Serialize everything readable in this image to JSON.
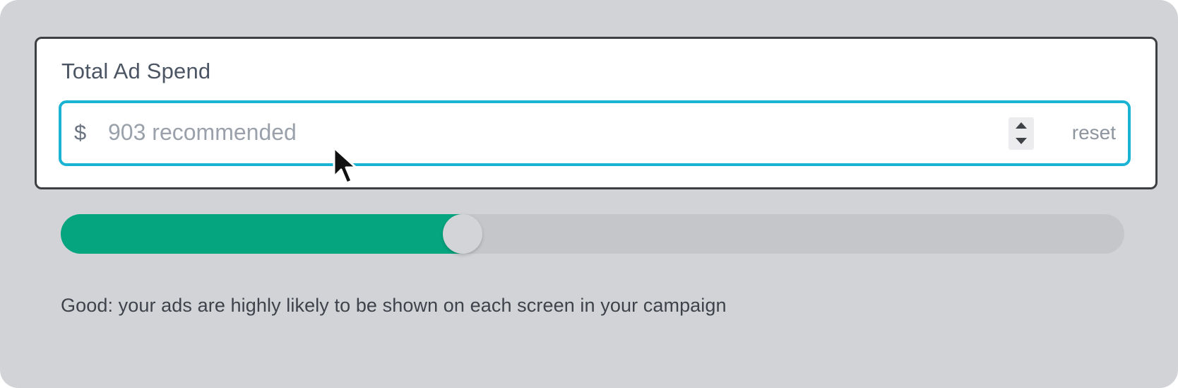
{
  "budget_field": {
    "label": "Total Ad Spend",
    "currency_symbol": "$",
    "value": "",
    "placeholder": "903 recommended",
    "reset_label": "reset"
  },
  "spend_slider": {
    "level_fraction": 0.378,
    "fill_color": "#05a57f",
    "track_color": "#c5c6ca"
  },
  "status_message": "Good: your ads are highly likely to be shown on each screen in your campaign",
  "colors": {
    "focus_ring": "#1ab3d3",
    "background": "#d1d3d6"
  },
  "icons": {
    "stepper_up": "chevron-up-icon",
    "stepper_down": "chevron-down-icon",
    "cursor": "mouse-pointer-icon"
  }
}
